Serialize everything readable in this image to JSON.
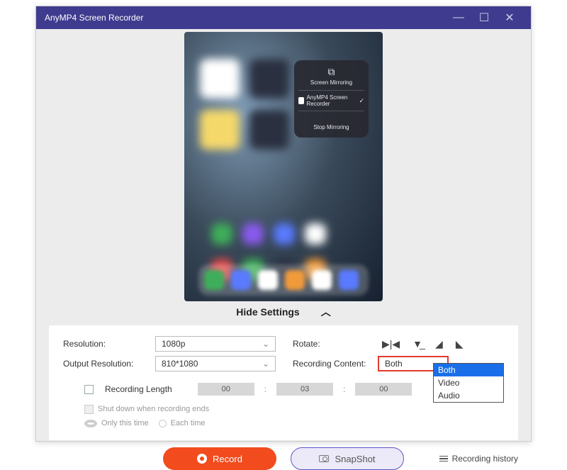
{
  "titlebar": {
    "title": "AnyMP4 Screen Recorder"
  },
  "mirror": {
    "title": "Screen Mirroring",
    "device": "AnyMP4 Screen Recorder",
    "stop": "Stop Mirroring"
  },
  "hide_settings": {
    "label": "Hide Settings"
  },
  "settings": {
    "resolution_label": "Resolution:",
    "resolution_value": "1080p",
    "output_resolution_label": "Output Resolution:",
    "output_resolution_value": "810*1080",
    "rotate_label": "Rotate:",
    "recording_content_label": "Recording Content:",
    "recording_content_value": "Both",
    "recording_content_options": [
      "Both",
      "Video",
      "Audio"
    ],
    "recording_length_label": "Recording Length",
    "time_hh": "00",
    "time_mm": "03",
    "time_ss": "00",
    "shutdown_label": "Shut down when recording ends",
    "only_this_time": "Only this time",
    "each_time": "Each time"
  },
  "actions": {
    "record": "Record",
    "snapshot": "SnapShot",
    "history": "Recording history"
  }
}
